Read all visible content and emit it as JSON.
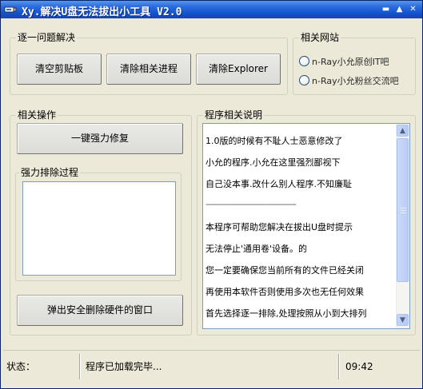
{
  "window": {
    "title": "Xy.解决U盘无法拔出小工具 V2.0",
    "buttons": {
      "minimize": "▬",
      "maximize": "▲",
      "close": "✕"
    }
  },
  "group_stepwise": {
    "legend": "逐一问题解决",
    "buttons": [
      "清空剪贴板",
      "清除相关进程",
      "清除Explorer"
    ]
  },
  "group_sites": {
    "legend": "相关网站",
    "options": [
      "n-Ray小允原创IT吧",
      "n-Ray小允粉丝交流吧"
    ]
  },
  "group_ops": {
    "legend": "相关操作",
    "force_repair_button": "一键强力修复",
    "process_group_legend": "强力排除过程",
    "eject_button": "弹出安全删除硬件的窗口"
  },
  "group_desc": {
    "legend": "程序相关说明",
    "lines": [
      "1.0版的时候有不耻人士恶意修改了",
      "小允的程序.小允在这里强烈鄙视下",
      "自己没本事.改什么别人程序.不知廉耻",
      "--------------------------------------",
      "本程序可帮助您解决在拔出U盘时提示",
      "无法停止'通用卷'设备。的",
      "您一定要确保您当前所有的文件已经关闭",
      "再使用本软件否则使用多次也无任何效果",
      "首先选择逐一排除,处理按照从小到大排列"
    ]
  },
  "statusbar": {
    "label": "状态：",
    "message": "程序已加载完毕...",
    "time": "09:42"
  }
}
